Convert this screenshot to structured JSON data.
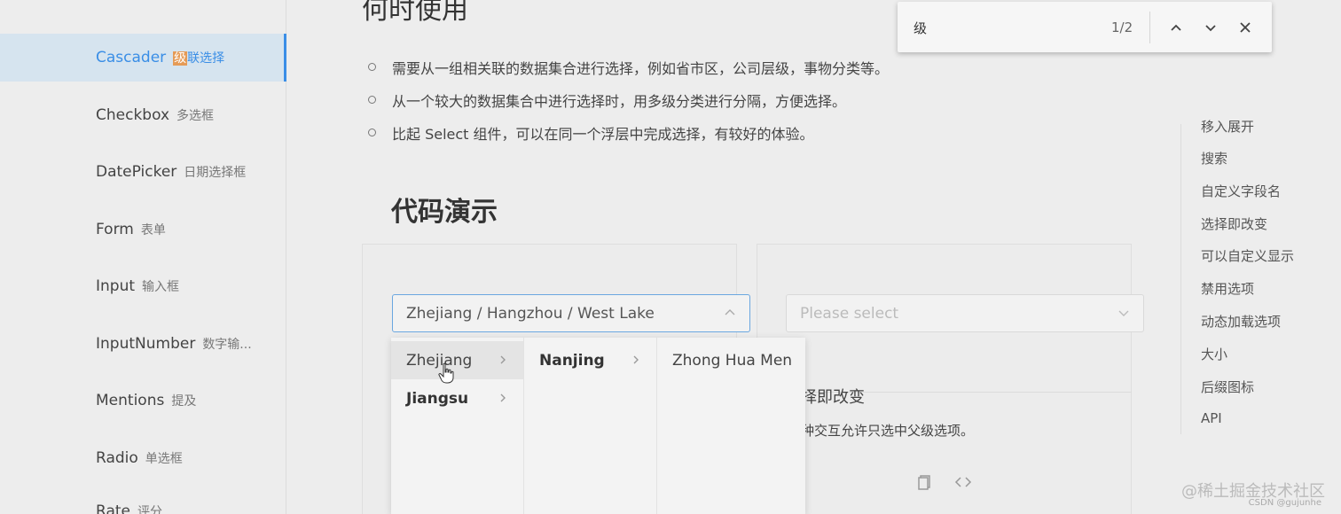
{
  "sidebar": {
    "items": [
      {
        "en": "Cascader",
        "zh_hl": "级",
        "zh": "联选择"
      },
      {
        "en": "Checkbox",
        "zh": "多选框"
      },
      {
        "en": "DatePicker",
        "zh": "日期选择框"
      },
      {
        "en": "Form",
        "zh": "表单"
      },
      {
        "en": "Input",
        "zh": "输入框"
      },
      {
        "en": "InputNumber",
        "zh": "数字输..."
      },
      {
        "en": "Mentions",
        "zh": "提及"
      },
      {
        "en": "Radio",
        "zh": "单选框"
      },
      {
        "en": "Rate",
        "zh": "评分"
      }
    ]
  },
  "main": {
    "when_title": "何时使用",
    "bullets": [
      "需要从一组相关联的数据集合进行选择，例如省市区，公司层级，事物分类等。",
      "从一个较大的数据集合中进行选择时，用多级分类进行分隔，方便选择。",
      "比起 Select 组件，可以在同一个浮层中完成选择，有较好的体验。"
    ],
    "demo_title": "代码演示",
    "cascader_value": "Zhejiang / Hangzhou / West Lake",
    "select_placeholder": "Please select",
    "dropdown": {
      "col1": [
        "Zhejiang",
        "Jiangsu"
      ],
      "col2": [
        "Nanjing"
      ],
      "col3": [
        "Zhong Hua Men"
      ]
    },
    "sub_title": "择即改变",
    "sub_desc": "种交互允许只选中父级选项。"
  },
  "anchor": {
    "items": [
      "移入展开",
      "搜索",
      "自定义字段名",
      "选择即改变",
      "可以自定义显示",
      "禁用选项",
      "动态加载选项",
      "大小",
      "后缀图标",
      "API"
    ]
  },
  "find": {
    "query": "级",
    "count": "1/2"
  },
  "watermark": {
    "main": "@稀土掘金技术社区",
    "sub": "CSDN @gujunhe"
  }
}
